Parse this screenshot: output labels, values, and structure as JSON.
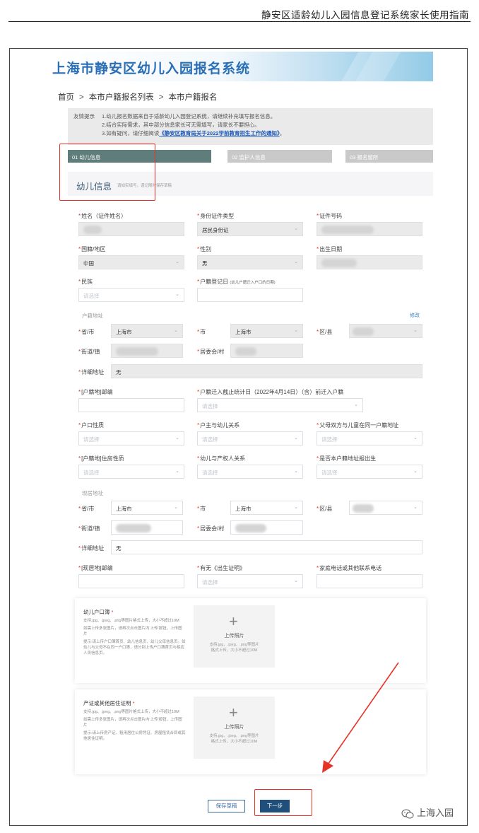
{
  "doc_header": {
    "title": "静安区适龄幼儿入园信息登记系统家长使用指南"
  },
  "banner": {
    "title": "上海市静安区幼儿入园报名系统"
  },
  "breadcrumb": {
    "items": [
      "首页",
      "本市户籍报名列表",
      "本市户籍报名"
    ],
    "sep": ">"
  },
  "tips": {
    "label": "友情提示",
    "line1": "1.幼儿报名数据来自于适龄幼儿入园登记系统，请继续补充填写报名信息。",
    "line2": "2.结合实际需求，其中部分信息家长可无需填写，请家长不要担心。",
    "line3_prefix": "3.如有疑问，请仔细阅读",
    "line3_link": "《静安区教育局关于2022学前教育招生工作的通知》",
    "line3_suffix": "。"
  },
  "steps": [
    "01 幼儿信息",
    "02 监护人信息",
    "03 报名留所"
  ],
  "section": {
    "title": "幼儿信息",
    "subtitle": "请如实填写，谨记随时保存草稿"
  },
  "form": {
    "name_label": "姓名（证件姓名）",
    "id_type_label": "身份证件类型",
    "id_type_value": "居民身份证",
    "id_no_label": "证件号码",
    "nation_label": "国籍/地区",
    "nation_value": "中国",
    "gender_label": "性别",
    "gender_value": "男",
    "birth_label": "出生日期",
    "ethnic_label": "民族",
    "ethnic_placeholder": "请选择",
    "hukou_date_label": "户籍登记日",
    "hukou_date_note": "(幼儿户籍迁入户口的日期)",
    "hukou_addr_group": "户籍地址",
    "edit_link": "修改",
    "province_label": "省/市",
    "province_value": "上海市",
    "city_label": "市",
    "city_value": "上海市",
    "district_label": "区/县",
    "street_label": "街道/镇",
    "committee_label": "居委会/村",
    "detail_label": "详细地址",
    "detail_value": "无",
    "hukou_postcode_label": "[户籍地]邮编",
    "migrate_label": "户籍迁入截止统计日（2022年4月14日）（含）前迁入户籍",
    "migrate_placeholder": "请选择",
    "hukou_nature_label": "户口性质",
    "hukou_nature_placeholder": "请选择",
    "householder_label": "户主与幼儿关系",
    "householder_placeholder": "请选择",
    "parents_same_label": "父母双方与儿童在同一户籍地址",
    "parents_same_placeholder": "请选择",
    "housing_nature_label": "[户籍地]住房性质",
    "housing_nature_placeholder": "请选择",
    "property_rel_label": "幼儿与产权人关系",
    "property_rel_placeholder": "请选择",
    "born_here_label": "是否本户籍地址报出生",
    "born_here_placeholder": "请选择",
    "current_addr_group": "现居地址",
    "cur_province_value": "上海市",
    "cur_city_value": "上海市",
    "cur_detail_value": "无",
    "cur_postcode_label": "[现居地]邮编",
    "birth_cert_label": "有无《出生证明》",
    "birth_cert_placeholder": "请选择",
    "phone_label": "家庭电话或其他联系电话"
  },
  "uploads": [
    {
      "title": "幼儿户口簿",
      "desc1": "支持.jpg、.jpeg、.png等图片格式上传，大小不超过10M",
      "desc2": "如需上传多张图片，请再次点击图片内'上传'按钮，上传图片",
      "desc3": "提示:请上传户口簿首页、幼儿信息页、幼儿父母信息页。如幼儿与父母不在同一户口簿，请分别上传户口簿首页与相应人员信息页。",
      "box_title": "上传照片",
      "box_hint": "支持.jpg、.jpeg、.png等图片格式上传，大小不超过10M"
    },
    {
      "title": "产证或其他居住证明",
      "desc1": "支持.jpg、.jpeg、.png等图片格式上传，大小不超过10M",
      "desc2": "如需上传多张图片，请再次点击图片内'上传'按钮，上传图片",
      "desc3": "提示:请上传房产证、租用居住公房凭证、房屋租赁合同或其他居住证明。",
      "box_title": "上传照片",
      "box_hint": "支持.jpg、.jpeg、.png等图片格式上传，大小不超过10M"
    }
  ],
  "buttons": {
    "save_draft": "保存草稿",
    "next": "下一步"
  },
  "watermark": {
    "text": "上海入园"
  },
  "colors": {
    "accent": "#1f4f7a",
    "step_active": "#5f7d7a",
    "highlight": "#e6332a",
    "link": "#1a57b7"
  }
}
